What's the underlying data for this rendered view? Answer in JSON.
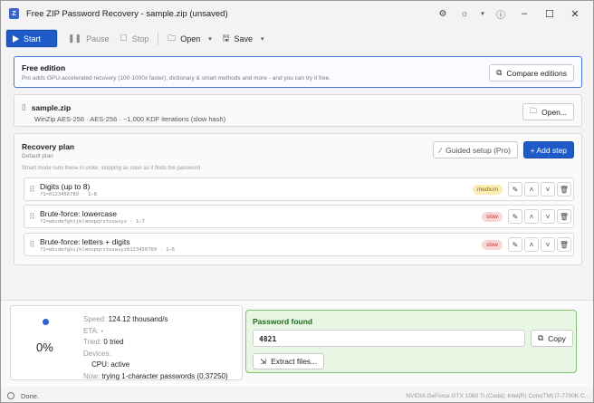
{
  "window": {
    "title": "Free ZIP Password Recovery - sample.zip (unsaved)"
  },
  "titlebar_icons": [
    "gear-icon",
    "sun-icon",
    "help-icon"
  ],
  "toolbar": {
    "start": "Start",
    "pause": "Pause",
    "stop": "Stop",
    "open": "Open",
    "save": "Save"
  },
  "free_edition": {
    "title": "Free edition",
    "description": "Pro adds GPU-accelerated recovery (100-1000x faster), dictionary & smart methods and more - and you can try it free.",
    "compare_button": "Compare editions"
  },
  "file": {
    "name": "sample.zip",
    "info": "WinZip AES-256 · AES-256 · ~1,000 KDF iterations (slow hash)",
    "open_button": "Open..."
  },
  "plan": {
    "title": "Recovery plan",
    "subtitle": "Default plan",
    "hint": "Smart mode runs these in order, stopping as soon as it finds the password",
    "guided_button": "Guided setup (Pro)",
    "add_button": "+ Add step",
    "steps": [
      {
        "name": "Digits (up to 8)",
        "detail": "?1=0123456789 · 1–8",
        "badge": "medium"
      },
      {
        "name": "Brute-force: lowercase",
        "detail": "?1=abcdefghijklmnopqrstuvwxyz · 1–7",
        "badge": "slow"
      },
      {
        "name": "Brute-force: letters + digits",
        "detail": "?1=abcdefghijklmnopqrstuvwxyz0123456789 · 1–6",
        "badge": "slow"
      }
    ]
  },
  "progress": {
    "percent": "0%",
    "speed_label": "Speed:",
    "speed": "124.12 thousand/s",
    "eta_label": "ETA:",
    "eta": "-",
    "tried_label": "Tried:",
    "tried": "0 tried",
    "devices_label": "Devices:",
    "cpu": "CPU: active",
    "now_label": "Now:",
    "now": "trying 1-character passwords (0.37250)"
  },
  "found": {
    "title": "Password found",
    "password": "4821",
    "copy_button": "Copy",
    "extract_button": "Extract files..."
  },
  "status": {
    "text": "Done.",
    "hardware": "NVIDIA GeForce GTX 1080 Ti (Cuda); Intel(R) Core(TM) i7-7700K C..."
  },
  "colors": {
    "accent": "#1f5bc8",
    "found_bg": "#e8f7e4",
    "found_border": "#7fc46f",
    "badge_medium": "#fbecb5",
    "badge_slow": "#fbd6d6"
  }
}
